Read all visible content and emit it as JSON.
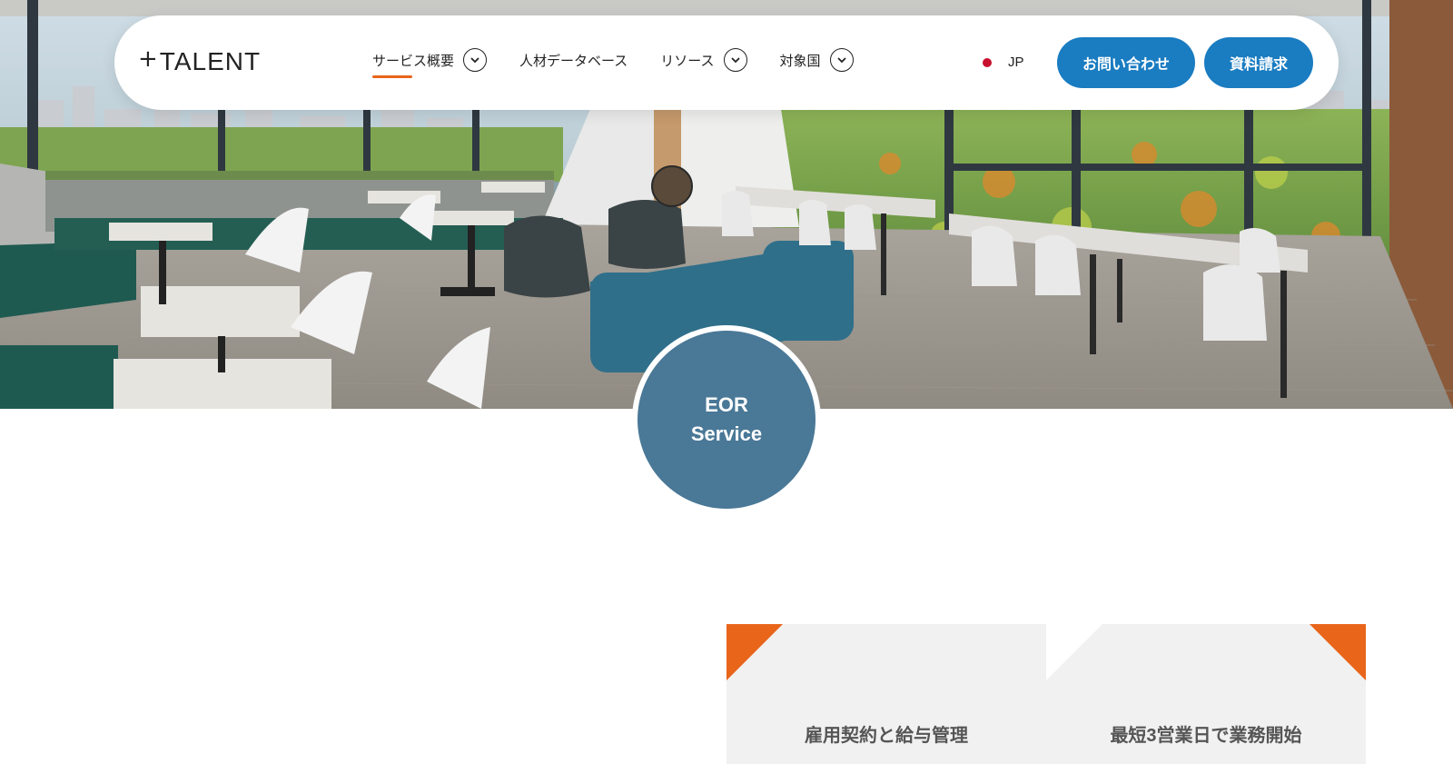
{
  "header": {
    "logo_mark": "+",
    "logo_text": "TALENT",
    "menu": [
      {
        "label": "サービス概要",
        "has_dropdown": true,
        "active": true
      },
      {
        "label": "人材データベース",
        "has_dropdown": false,
        "active": false
      },
      {
        "label": "リソース",
        "has_dropdown": true,
        "active": false
      },
      {
        "label": "対象国",
        "has_dropdown": true,
        "active": false
      }
    ],
    "language": "JP",
    "contact_button": "お問い合わせ",
    "docs_button": "資料請求"
  },
  "hero": {
    "badge_line1": "EOR",
    "badge_line2": "Service"
  },
  "features": [
    {
      "title": "雇用契約と給与管理"
    },
    {
      "title": "最短3営業日で業務開始"
    }
  ],
  "colors": {
    "accent_orange": "#e8651a",
    "primary_blue": "#1a7cc1",
    "badge_blue": "#4a7897",
    "flag_red": "#c8102e",
    "card_gray": "#f1f1f1"
  }
}
